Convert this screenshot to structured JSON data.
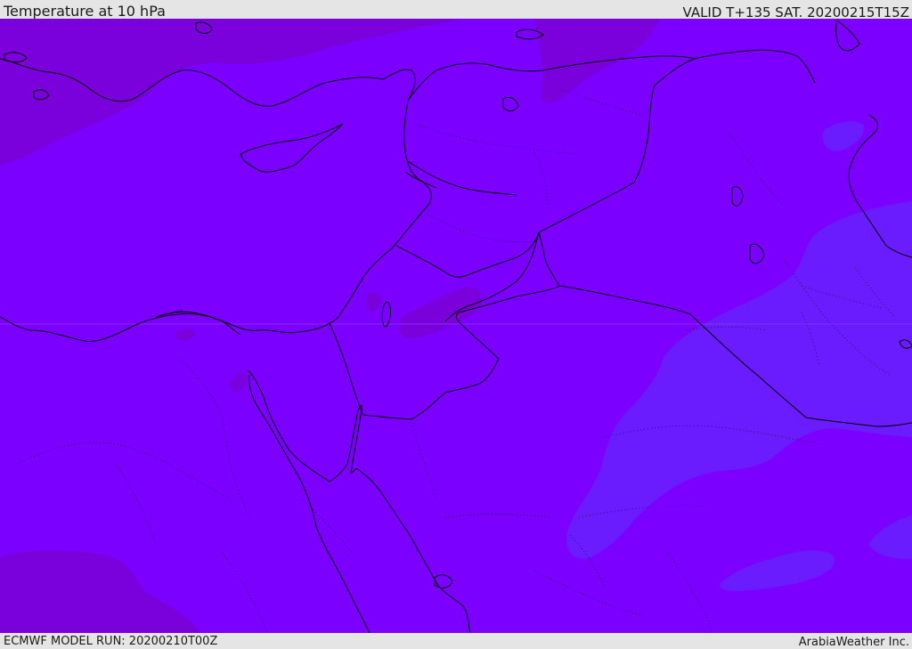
{
  "header": {
    "title": "Temperature at 10 hPa",
    "valid_time": "VALID T+135 SAT. 20200215T15Z"
  },
  "footer": {
    "model_run": "ECMWF MODEL RUN: 20200210T00Z",
    "credit": "ArabiaWeather Inc."
  },
  "map": {
    "colors": {
      "base": "#7b00ff",
      "warmer": "#7a00dc",
      "cooler": "#6a1cff",
      "coast": "#000000"
    }
  }
}
